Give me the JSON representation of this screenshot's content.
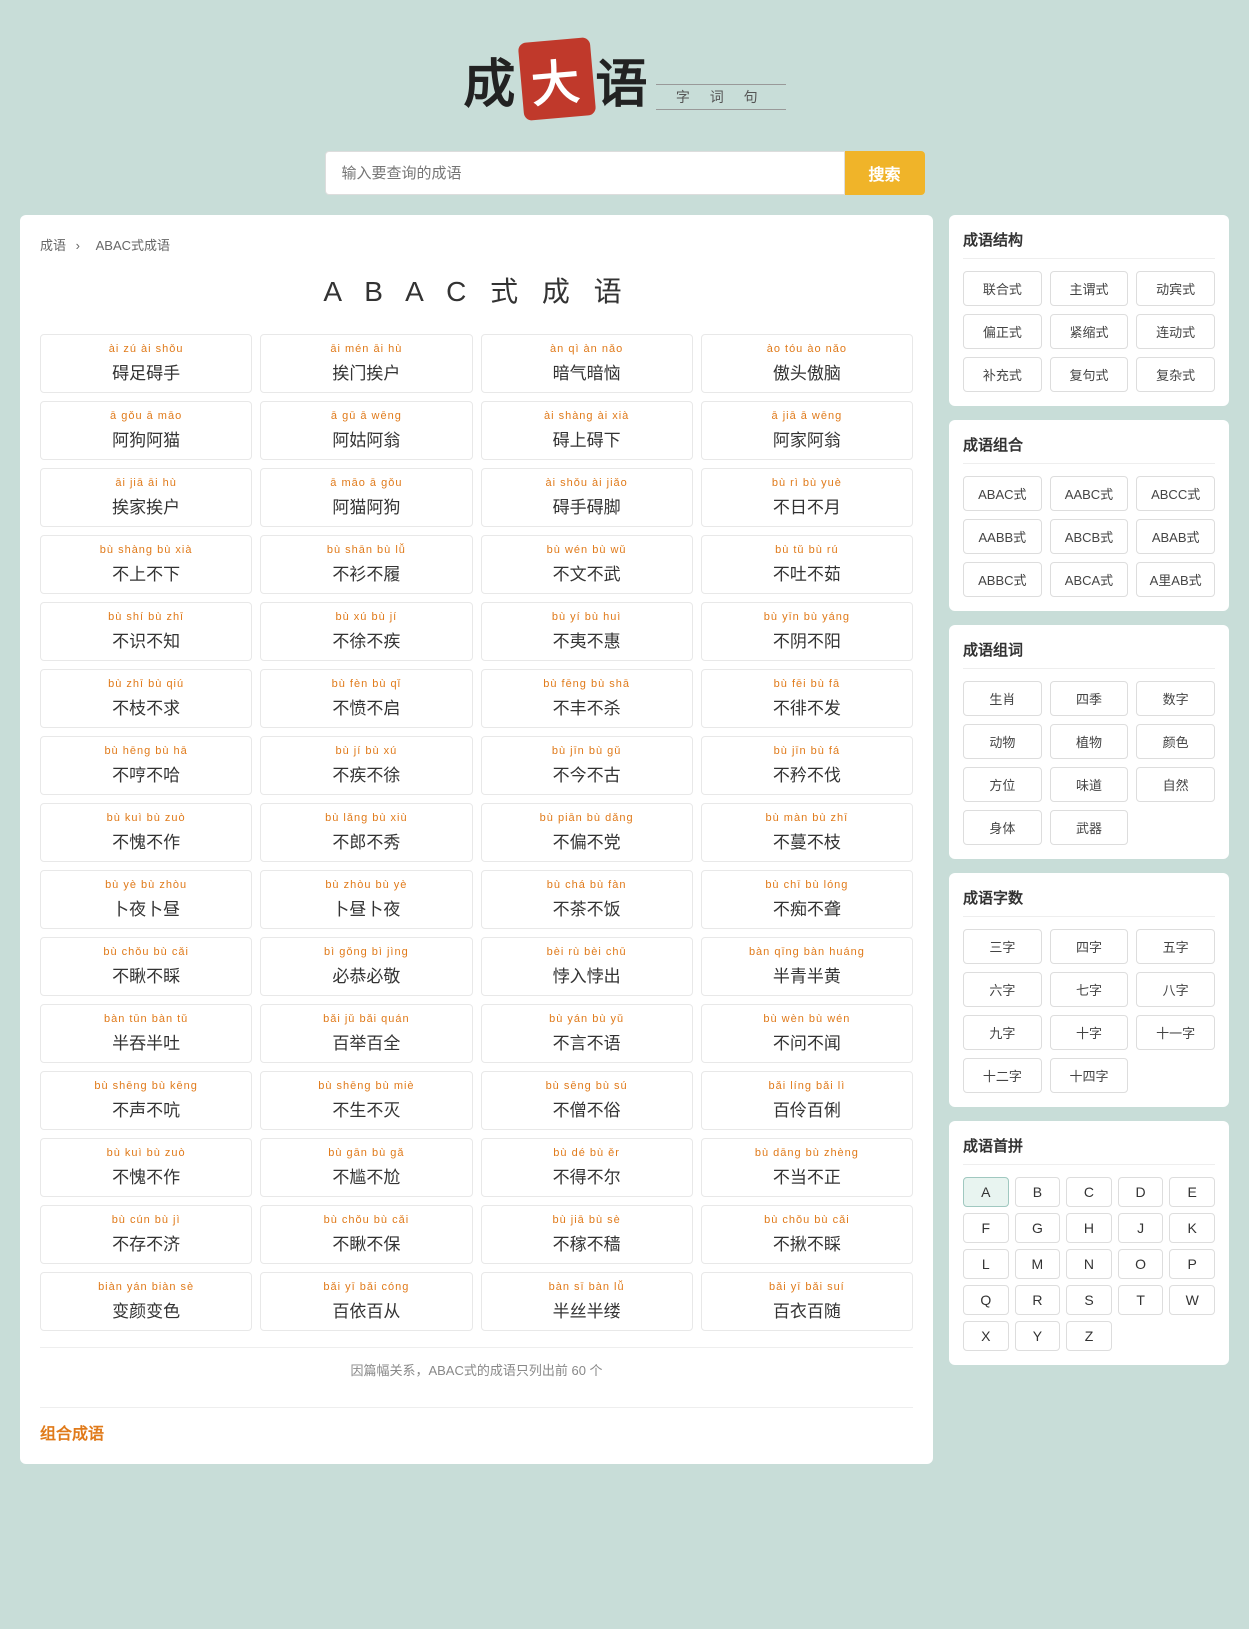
{
  "logo": {
    "part1": "成",
    "part_da": "大",
    "part3": "语",
    "subtitle": "字 词 句"
  },
  "search": {
    "placeholder": "输入要查询的成语",
    "button_label": "搜索"
  },
  "breadcrumb": {
    "home": "成语",
    "separator": "›",
    "current": "ABAC式成语"
  },
  "page_title": "A B A C 式 成 语",
  "idioms": [
    {
      "pinyin": "ài zú ài shǒu",
      "chinese": "碍足碍手"
    },
    {
      "pinyin": "āi mén āi hù",
      "chinese": "挨门挨户"
    },
    {
      "pinyin": "àn qì àn nǎo",
      "chinese": "暗气暗恼"
    },
    {
      "pinyin": "ào tóu ào nǎo",
      "chinese": "傲头傲脑"
    },
    {
      "pinyin": "ā gǒu ā māo",
      "chinese": "阿狗阿猫"
    },
    {
      "pinyin": "ā gū ā wēng",
      "chinese": "阿姑阿翁"
    },
    {
      "pinyin": "ài shàng ài xià",
      "chinese": "碍上碍下"
    },
    {
      "pinyin": "ā jiā ā wēng",
      "chinese": "阿家阿翁"
    },
    {
      "pinyin": "āi jiā āi hù",
      "chinese": "挨家挨户"
    },
    {
      "pinyin": "ā māo ā gǒu",
      "chinese": "阿猫阿狗"
    },
    {
      "pinyin": "ài shǒu ài jiǎo",
      "chinese": "碍手碍脚"
    },
    {
      "pinyin": "bù rì bù yuè",
      "chinese": "不日不月"
    },
    {
      "pinyin": "bù shàng bù xià",
      "chinese": "不上不下"
    },
    {
      "pinyin": "bù shān bù lǚ",
      "chinese": "不衫不履"
    },
    {
      "pinyin": "bù wén bù wǔ",
      "chinese": "不文不武"
    },
    {
      "pinyin": "bù tǔ bù rú",
      "chinese": "不吐不茹"
    },
    {
      "pinyin": "bù shí bù zhī",
      "chinese": "不识不知"
    },
    {
      "pinyin": "bù xú bù jí",
      "chinese": "不徐不疾"
    },
    {
      "pinyin": "bù yí bù huì",
      "chinese": "不夷不惠"
    },
    {
      "pinyin": "bù yīn bù yáng",
      "chinese": "不阴不阳"
    },
    {
      "pinyin": "bù zhī bù qiú",
      "chinese": "不枝不求"
    },
    {
      "pinyin": "bù fèn bù qǐ",
      "chinese": "不愤不启"
    },
    {
      "pinyin": "bù fēng bù shā",
      "chinese": "不丰不杀"
    },
    {
      "pinyin": "bù fēi bù fā",
      "chinese": "不徘不发"
    },
    {
      "pinyin": "bù hēng bù hā",
      "chinese": "不哼不哈"
    },
    {
      "pinyin": "bù jí bù xú",
      "chinese": "不疾不徐"
    },
    {
      "pinyin": "bù jīn bù gǔ",
      "chinese": "不今不古"
    },
    {
      "pinyin": "bù jīn bù fá",
      "chinese": "不矜不伐"
    },
    {
      "pinyin": "bù kuì bù zuò",
      "chinese": "不愧不作"
    },
    {
      "pinyin": "bù lǎng bù xiù",
      "chinese": "不郎不秀"
    },
    {
      "pinyin": "bù piān bù dǎng",
      "chinese": "不偏不党"
    },
    {
      "pinyin": "bù màn bù zhī",
      "chinese": "不蔓不枝"
    },
    {
      "pinyin": "bù yè bù zhòu",
      "chinese": "卜夜卜昼"
    },
    {
      "pinyin": "bù zhòu bù yè",
      "chinese": "卜昼卜夜"
    },
    {
      "pinyin": "bù chá bù fàn",
      "chinese": "不茶不饭"
    },
    {
      "pinyin": "bù chī bù lóng",
      "chinese": "不痴不聋"
    },
    {
      "pinyin": "bù chǒu bù cǎi",
      "chinese": "不瞅不睬"
    },
    {
      "pinyin": "bì gǒng bì jìng",
      "chinese": "必恭必敬"
    },
    {
      "pinyin": "bèi rù bèi chū",
      "chinese": "悖入悖出"
    },
    {
      "pinyin": "bàn qīng bàn huáng",
      "chinese": "半青半黄"
    },
    {
      "pinyin": "bàn tūn bàn tǔ",
      "chinese": "半吞半吐"
    },
    {
      "pinyin": "bǎi jǔ bǎi quán",
      "chinese": "百举百全"
    },
    {
      "pinyin": "bù yán bù yǔ",
      "chinese": "不言不语"
    },
    {
      "pinyin": "bù wèn bù wén",
      "chinese": "不问不闻"
    },
    {
      "pinyin": "bù shēng bù kēng",
      "chinese": "不声不吭"
    },
    {
      "pinyin": "bù shēng bù miè",
      "chinese": "不生不灭"
    },
    {
      "pinyin": "bù sēng bù sú",
      "chinese": "不僧不俗"
    },
    {
      "pinyin": "bǎi líng bǎi lì",
      "chinese": "百伶百俐"
    },
    {
      "pinyin": "bù kuì bù zuò",
      "chinese": "不愧不作"
    },
    {
      "pinyin": "bù gān bù gǎ",
      "chinese": "不尴不尬"
    },
    {
      "pinyin": "bù dé bù ěr",
      "chinese": "不得不尔"
    },
    {
      "pinyin": "bù dāng bù zhèng",
      "chinese": "不当不正"
    },
    {
      "pinyin": "bù cún bù jì",
      "chinese": "不存不济"
    },
    {
      "pinyin": "bù chǒu bù cǎi",
      "chinese": "不瞅不保"
    },
    {
      "pinyin": "bù jiā bù sè",
      "chinese": "不稼不穑"
    },
    {
      "pinyin": "bù chǒu bù cǎi",
      "chinese": "不揪不睬"
    },
    {
      "pinyin": "biàn yán biàn sè",
      "chinese": "变颜变色"
    },
    {
      "pinyin": "bǎi yī bǎi cóng",
      "chinese": "百依百从"
    },
    {
      "pinyin": "bàn sī bàn lǚ",
      "chinese": "半丝半缕"
    },
    {
      "pinyin": "bǎi yī bǎi suí",
      "chinese": "百衣百随"
    }
  ],
  "footnote": "因篇幅关系，ABAC式的成语只列出前 60 个",
  "section_bottom_title": "组合成语",
  "sidebar": {
    "structure_title": "成语结构",
    "structure_items": [
      "联合式",
      "主谓式",
      "动宾式",
      "偏正式",
      "紧缩式",
      "连动式",
      "补充式",
      "复句式",
      "复杂式"
    ],
    "combo_title": "成语组合",
    "combo_items": [
      "ABAC式",
      "AABC式",
      "ABCC式",
      "AABB式",
      "ABCB式",
      "ABAB式",
      "ABBC式",
      "ABCA式",
      "A里AB式"
    ],
    "word_title": "成语组词",
    "word_items": [
      "生肖",
      "四季",
      "数字",
      "动物",
      "植物",
      "颜色",
      "方位",
      "味道",
      "自然",
      "身体",
      "武器"
    ],
    "char_title": "成语字数",
    "char_items": [
      "三字",
      "四字",
      "五字",
      "六字",
      "七字",
      "八字",
      "九字",
      "十字",
      "十一字",
      "十二字",
      "十四字"
    ],
    "pinyin_title": "成语首拼",
    "pinyin_letters": [
      "A",
      "B",
      "C",
      "D",
      "E",
      "F",
      "G",
      "H",
      "J",
      "K",
      "L",
      "M",
      "N",
      "O",
      "P",
      "Q",
      "R",
      "S",
      "T",
      "W",
      "X",
      "Y",
      "Z"
    ]
  }
}
